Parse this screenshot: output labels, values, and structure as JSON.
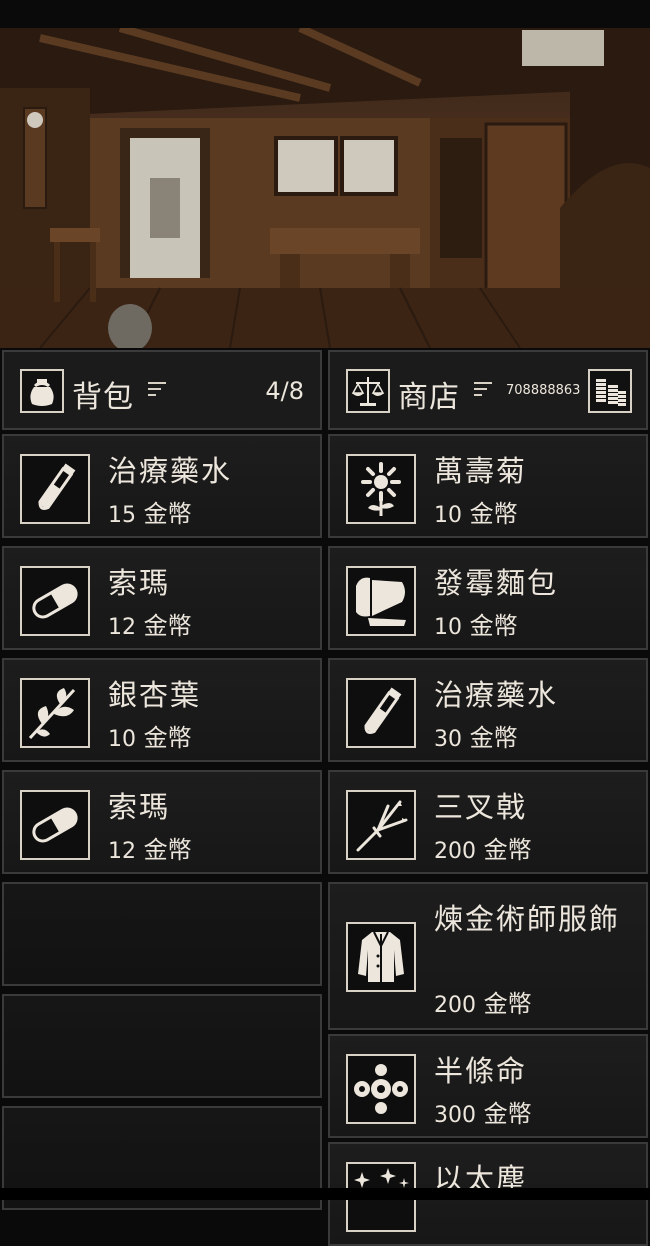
{
  "inventory": {
    "title": "背包",
    "count": "4/8",
    "items": [
      {
        "name": "治療藥水",
        "price": "15",
        "currency": "金幣",
        "icon": "potion-icon"
      },
      {
        "name": "索瑪",
        "price": "12",
        "currency": "金幣",
        "icon": "pill-icon"
      },
      {
        "name": "銀杏葉",
        "price": "10",
        "currency": "金幣",
        "icon": "leaf-icon"
      },
      {
        "name": "索瑪",
        "price": "12",
        "currency": "金幣",
        "icon": "pill-icon"
      }
    ]
  },
  "shop": {
    "title": "商店",
    "coins": "708888863",
    "items": [
      {
        "name": "萬壽菊",
        "price": "10",
        "currency": "金幣",
        "icon": "flower-icon"
      },
      {
        "name": "發霉麵包",
        "price": "10",
        "currency": "金幣",
        "icon": "bread-icon"
      },
      {
        "name": "治療藥水",
        "price": "30",
        "currency": "金幣",
        "icon": "potion-icon"
      },
      {
        "name": "三叉戟",
        "price": "200",
        "currency": "金幣",
        "icon": "trident-icon"
      },
      {
        "name": "煉金術師服飾",
        "price": "200",
        "currency": "金幣",
        "icon": "coat-icon"
      },
      {
        "name": "半條命",
        "price": "300",
        "currency": "金幣",
        "icon": "orbs-icon"
      },
      {
        "name": "以太塵",
        "price": "",
        "currency": "",
        "icon": "stars-icon"
      }
    ]
  },
  "colors": {
    "panel": "#1b1b1b",
    "border": "#3a3a3a",
    "text": "#ece6dc"
  }
}
